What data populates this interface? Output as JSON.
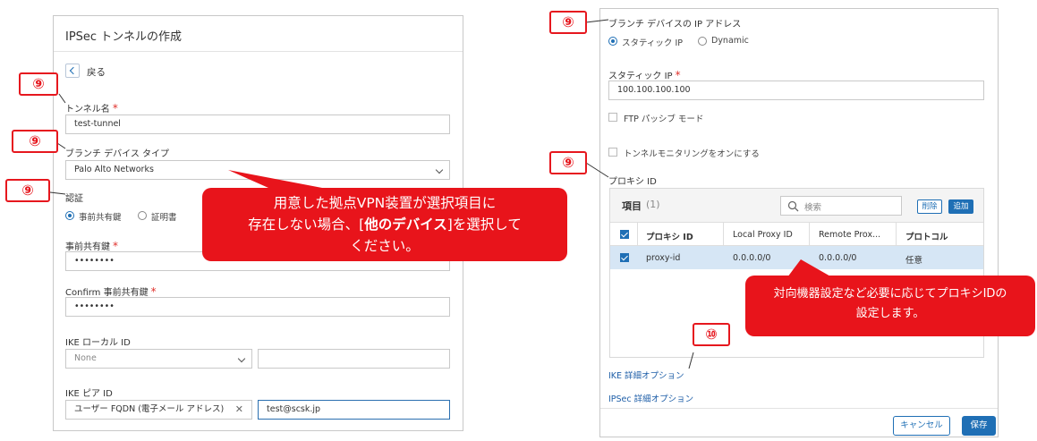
{
  "left": {
    "title": "IPSec トンネルの作成",
    "back_label": "戻る",
    "tunnel_name_label": "トンネル名",
    "tunnel_name_value": "test-tunnel",
    "branch_type_label": "ブランチ デバイス タイプ",
    "branch_type_value": "Palo Alto Networks",
    "auth_label": "認証",
    "auth_options": [
      "事前共有鍵",
      "証明書"
    ],
    "psk_label": "事前共有鍵",
    "psk_value": "••••••••",
    "confirm_label": "Confirm 事前共有鍵",
    "confirm_value": "••••••••",
    "ike_local_label": "IKE ローカル ID",
    "ike_local_value": "None",
    "ike_peer_label": "IKE ピア ID",
    "ike_peer_type": "ユーザー FQDN (電子メール アドレス)",
    "ike_peer_value": "test@scsk.jp"
  },
  "right": {
    "branch_ip_label": "ブランチ デバイスの IP アドレス",
    "ip_options": [
      "スタティック IP",
      "Dynamic"
    ],
    "static_ip_label": "スタティック IP",
    "static_ip_value": "100.100.100.100",
    "ftp_label": "FTP パッシブ モード",
    "tunnel_monitor_label": "トンネルモニタリングをオンにする",
    "proxy_label": "プロキシ ID",
    "items_label": "項目",
    "items_count": "(1)",
    "search_placeholder": "検索",
    "delete_label": "削除",
    "add_label": "追加",
    "columns": [
      "プロキシ ID",
      "Local Proxy ID",
      "Remote Prox...",
      "プロトコル"
    ],
    "rows": [
      [
        "proxy-id",
        "0.0.0.0/0",
        "0.0.0.0/0",
        "任意"
      ]
    ],
    "ike_adv_link": "IKE 詳細オプション",
    "ipsec_adv_link": "IPSec 詳細オプション",
    "cancel_label": "キャンセル",
    "save_label": "保存"
  },
  "annotations": {
    "tag9": "⑨",
    "tag10": "⑩",
    "callout1_line1": "用意した拠点VPN装置が選択項目に",
    "callout1_line2_a": "存在しない場合、[",
    "callout1_line2_b": "他のデバイス",
    "callout1_line2_c": "]を選択して",
    "callout1_line3": "ください。",
    "callout2_line1": "対向機器設定など必要に応じてプロキシIDの",
    "callout2_line2": "設定します。"
  },
  "colors": {
    "accent": "#1f6fb5",
    "annotation": "#e6171e",
    "selected_row": "#d6e6f5"
  }
}
